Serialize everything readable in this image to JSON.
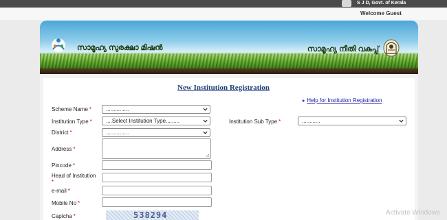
{
  "header": {
    "govt_label": "S J D, Govt. of Kerala",
    "welcome_text": "Welcome Guest"
  },
  "banner": {
    "left_title": "സാമൂഹ്യ സുരക്ഷാ മിഷൻ",
    "right_title": "സാമൂഹ്യ നീതി വകുപ്പ്"
  },
  "page": {
    "title": "New Institution Registration",
    "help_link": "Help for Institution Registration"
  },
  "form": {
    "scheme_name": {
      "label": "Scheme Name",
      "required": "*",
      "value": "..............."
    },
    "institution_type": {
      "label": "Institution Type",
      "required": "*",
      "value": "....Select Institution Type........."
    },
    "institution_sub_type": {
      "label": "Institution Sub Type",
      "required": "*",
      "value": "............"
    },
    "district": {
      "label": "District",
      "required": "*",
      "value": "..............."
    },
    "address": {
      "label": "Address",
      "required": "*",
      "value": ""
    },
    "pincode": {
      "label": "Pincode",
      "required": "*",
      "value": ""
    },
    "head_of_institution": {
      "label_line1": "Head of Institution",
      "required": "*",
      "value": ""
    },
    "email": {
      "label": "e-mail",
      "required": "*",
      "value": ""
    },
    "mobile_no": {
      "label": "Mobile No",
      "required": "*",
      "value": ""
    },
    "captcha": {
      "label": "Captcha",
      "required": "*",
      "image_text": "538294"
    }
  },
  "system": {
    "watermark": "Activate Windows"
  },
  "colors": {
    "topbar": "#4a4a4a",
    "title": "#1f3f7a",
    "required": "#d40000",
    "link": "#1a1aa8"
  }
}
